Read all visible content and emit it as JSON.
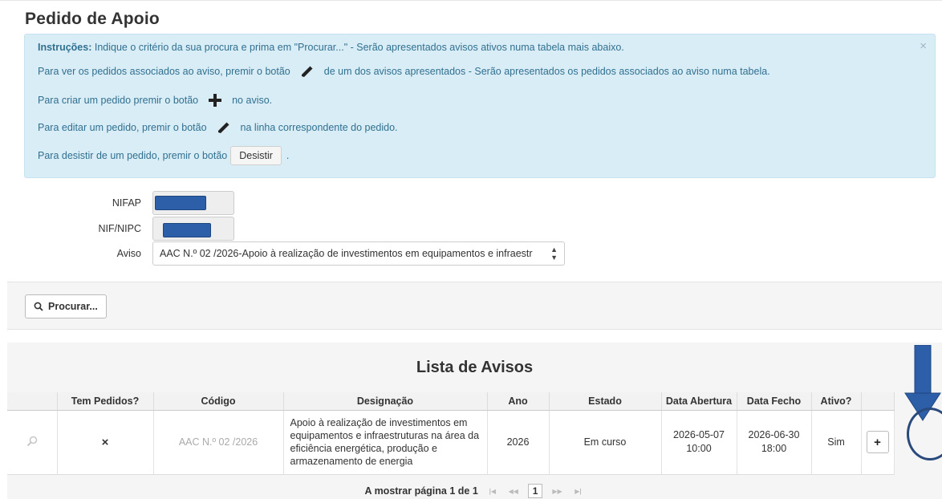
{
  "page": {
    "title": "Pedido de Apoio"
  },
  "instructions": {
    "close": "×",
    "line1_bold": "Instruções:",
    "line1_text": " Indique o critério da sua procura e prima em \"Procurar...\" - Serão apresentados avisos ativos numa tabela mais abaixo.",
    "line2_pre": "Para ver os pedidos associados ao aviso, premir o botão",
    "line2_post": "de um dos avisos apresentados - Serão apresentados os pedidos associados ao aviso numa tabela.",
    "line3_pre": "Para criar um pedido premir o botão",
    "line3_post": "no aviso.",
    "line4_pre": "Para editar um pedido, premir o botão",
    "line4_post": "na linha correspondente do pedido.",
    "line5_pre": "Para desistir de um pedido, premir o botão",
    "line5_button": "Desistir",
    "line5_post": "."
  },
  "form": {
    "nifap_label": "NIFAP",
    "nif_label": "NIF/NIPC",
    "aviso_label": "Aviso",
    "aviso_value": "AAC N.º 02 /2026-Apoio à realização de investimentos em equipamentos e infraestr"
  },
  "search": {
    "button_label": "Procurar..."
  },
  "list": {
    "title": "Lista de Avisos",
    "columns": [
      "",
      "Tem Pedidos?",
      "Código",
      "Designação",
      "Ano",
      "Estado",
      "Data Abertura",
      "Data Fecho",
      "Ativo?",
      ""
    ],
    "rows": [
      {
        "tem_pedidos": "×",
        "codigo": "AAC N.º 02 /2026",
        "designacao": "Apoio à realização de investimentos em equipamentos e infraestruturas na área da eficiência energética, produção e armazenamento de energia",
        "ano": "2026",
        "estado": "Em curso",
        "data_abertura": "2026-05-07 10:00",
        "data_fecho": "2026-06-30 18:00",
        "ativo": "Sim",
        "action": "+"
      }
    ],
    "pager_text": "A mostrar página 1 de 1",
    "pager_current": "1"
  },
  "colors": {
    "alert_bg": "#d9edf7",
    "alert_text": "#31708f",
    "annotation": "#2d5fa8"
  },
  "icons": {
    "pencil": "pencil-icon",
    "plus": "plus-icon",
    "search": "search-icon",
    "magnifier": "view-icon"
  }
}
